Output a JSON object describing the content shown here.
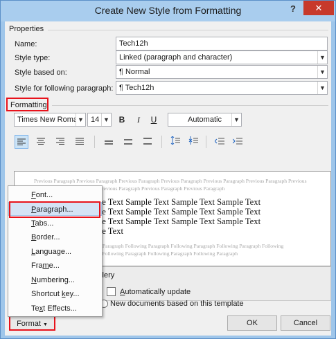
{
  "window": {
    "title": "Create New Style from Formatting",
    "help_glyph": "?",
    "close_glyph": "✕"
  },
  "properties": {
    "heading": "Properties",
    "name_label": "Name:",
    "name_value": "Tech12h",
    "style_type_label": "Style type:",
    "style_type_value": "Linked (paragraph and character)",
    "based_on_label": "Style based on:",
    "based_on_value": "¶ Normal",
    "following_label": "Style for following paragraph:",
    "following_value": "¶ Tech12h"
  },
  "formatting": {
    "heading": "Formatting",
    "font": "Times New Roman",
    "size": "14",
    "bold": "B",
    "italic": "I",
    "underline": "U",
    "color": "Automatic"
  },
  "preview": {
    "previous_lines": [
      "Previous Paragraph Previous Paragraph Previous Paragraph Previous Paragraph Previous Paragraph Previous Paragraph Previous",
      "Paragraph Previous Paragraph Previous Paragraph Previous Paragraph Previous Paragraph"
    ],
    "sample_lines": [
      "Sample Text Sample Text Sample Text Sample Text Sample Text",
      "Sample Text Sample Text Sample Text Sample Text Sample Text",
      "Sample Text Sample Text Sample Text Sample Text Sample Text",
      "Sample Text Sample Text"
    ],
    "following_lines": [
      "Following Paragraph Following Paragraph Following Paragraph Following Paragraph Following Paragraph Following",
      "Paragraph Following Paragraph Following Paragraph Following Paragraph Following Paragraph"
    ]
  },
  "description_fragment": "allery",
  "options": {
    "auto_update_label": "Automatically update",
    "new_docs_label": "New documents based on this template"
  },
  "buttons": {
    "format_label": "Format",
    "ok_label": "OK",
    "cancel_label": "Cancel"
  },
  "format_menu": {
    "items": [
      "Font...",
      "Paragraph...",
      "Tabs...",
      "Border...",
      "Language...",
      "Frame...",
      "Numbering...",
      "Shortcut key...",
      "Text Effects..."
    ],
    "highlighted_item": "Paragraph..."
  },
  "colors": {
    "highlight_box": "#e8121b",
    "close_button": "#c7392b",
    "title_bar": "#a9cdee"
  }
}
